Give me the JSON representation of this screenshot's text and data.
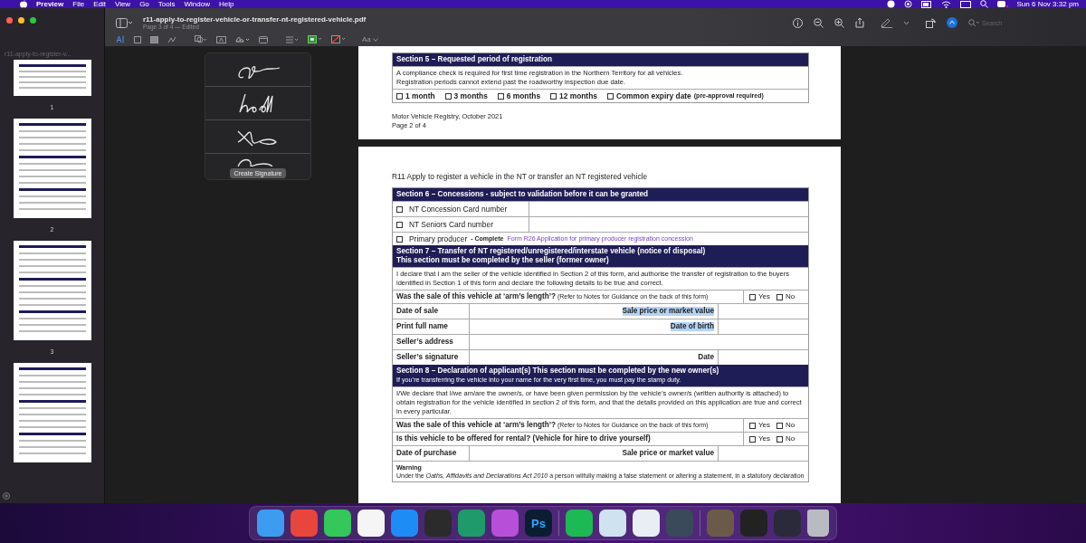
{
  "menu_bar": {
    "app": "Preview",
    "items": [
      "File",
      "Edit",
      "View",
      "Go",
      "Tools",
      "Window",
      "Help"
    ],
    "clock": "Sun 6 Nov  3:32 pm"
  },
  "window": {
    "title": "r11-apply-to-register-vehicle-or-transfer-nt-registered-vehicle.pdf",
    "subtitle": "Page 3 of 4 — Edited"
  },
  "toolbar": {
    "font_button": "Aa",
    "search": {
      "placeholder": "Search"
    }
  },
  "sidebar": {
    "title": "r11-apply-to-register-v...",
    "thumbnails": [
      {
        "kind": "cut",
        "label": "1"
      },
      {
        "kind": "page",
        "label": "2"
      },
      {
        "kind": "page",
        "label": "3"
      },
      {
        "kind": "page"
      }
    ]
  },
  "signature_popover": {
    "button": "Create Signature"
  },
  "page_2": {
    "section_5": {
      "title": "Section 5 – Requested period of registration",
      "lines": [
        "A compliance check is required for first time registration in the Northern Territory for all vehicles.",
        "Registration periods cannot extend past the roadworthy inspection due date."
      ],
      "options": [
        {
          "label": "1 month",
          "checked": false
        },
        {
          "label": "3 months",
          "checked": false
        },
        {
          "label": "6 months",
          "checked": false
        },
        {
          "label": "12 months",
          "checked": false
        },
        {
          "label": "Common expiry date",
          "note": "(pre-approval required)",
          "checked": false
        }
      ]
    },
    "footer": [
      "Motor Vehicle Registry, October 2021",
      "Page 2 of 4"
    ]
  },
  "page_3": {
    "heading": "R11 Apply to register a vehicle in the NT or transfer an NT registered vehicle",
    "section_6": {
      "title": "Section 6 – Concessions - subject to validation before it can be granted",
      "rows": [
        {
          "label": "NT Concession Card number",
          "checked": false
        },
        {
          "label": "NT Seniors Card number",
          "checked": false
        }
      ],
      "producer": {
        "label": "Primary producer",
        "checked": false,
        "note": " - Complete ",
        "link": "Form R26 Application for primary producer registration concession"
      }
    },
    "section_7": {
      "title": "Section 7 – Transfer of NT registered/unregistered/interstate vehicle (notice of disposal)",
      "subtitle": "This section must be completed by the seller (former owner)",
      "declaration": "I declare that I am the seller of the vehicle identified in Section 2 of this form, and authorise the transfer of registration to the buyers identified in Section 1 of this form and declare the following details to be true and correct.",
      "question": {
        "text": "Was the sale of this vehicle at ‘arm’s length’?",
        "note": "(Refer to Notes for Guidance on the back of this form)",
        "yes": {
          "label": "Yes",
          "checked": false
        },
        "no": {
          "label": "No",
          "checked": false
        }
      },
      "fields": [
        {
          "label": "Date of sale",
          "second": {
            "label": "Sale price or market value",
            "highlighted": true
          }
        },
        {
          "label": "Print full name",
          "second": {
            "label": "Date of birth",
            "highlighted": true
          }
        },
        {
          "label": "Seller’s address"
        },
        {
          "label": "Seller’s signature",
          "second": {
            "label": "Date",
            "highlighted": false
          }
        }
      ]
    },
    "section_8": {
      "title": "Section 8 – Declaration of applicant(s) This section must be completed by the new owner(s)",
      "subtitle": "If you’re transferring the vehicle into your name for the very first time, you must pay the stamp duty.",
      "declaration": "I/We declare that I/we am/are the owner/s, or have been given permission by the vehicle’s owner/s (written authority is attached) to obtain registration for the vehicle identified in section 2 of this form, and that the details provided on this application are true and correct in every particular.",
      "questions": [
        {
          "text": "Was the sale of this vehicle at ‘arm’s length’?",
          "note": "(Refer to Notes for Guidance on the back of this form)",
          "yes": {
            "label": "Yes",
            "checked": false
          },
          "no": {
            "label": "No",
            "checked": false
          }
        },
        {
          "text": "Is this vehicle to be offered for rental? (Vehicle for hire to drive yourself)",
          "yes": {
            "label": "Yes",
            "checked": false
          },
          "no": {
            "label": "No",
            "checked": false
          }
        }
      ],
      "fields": [
        {
          "label": "Date of purchase",
          "second": {
            "label": "Sale price or market value",
            "highlighted": false
          }
        }
      ],
      "warning": {
        "title": "Warning",
        "text": "Under the *Oaths, Affidavits and Declarations Act 2010* a person wilfully making a false statement or altering a statement, in a statutory declaration"
      }
    }
  },
  "dock": [
    {
      "color": "#3d9bf0"
    },
    {
      "color": "#e8453c"
    },
    {
      "color": "#34c759"
    },
    {
      "color": "#f5f5f5"
    },
    {
      "color": "#1e8cf5"
    },
    {
      "color": "#2b2b2b"
    },
    {
      "color": "#1f9a6a"
    },
    {
      "color": "#b84fd8"
    },
    {
      "color": "#0b1d33",
      "label": "Ps"
    },
    {
      "color": "#1db954",
      "divider": true
    },
    {
      "color": "#cfe2f0"
    },
    {
      "color": "#e9eef5"
    },
    {
      "color": "#3a4a5a"
    },
    {
      "color": "#6b5a4a",
      "divider": true
    },
    {
      "color": "#222222"
    },
    {
      "color": "#2a2a3a"
    },
    {
      "color": "#b8bcc2"
    }
  ]
}
